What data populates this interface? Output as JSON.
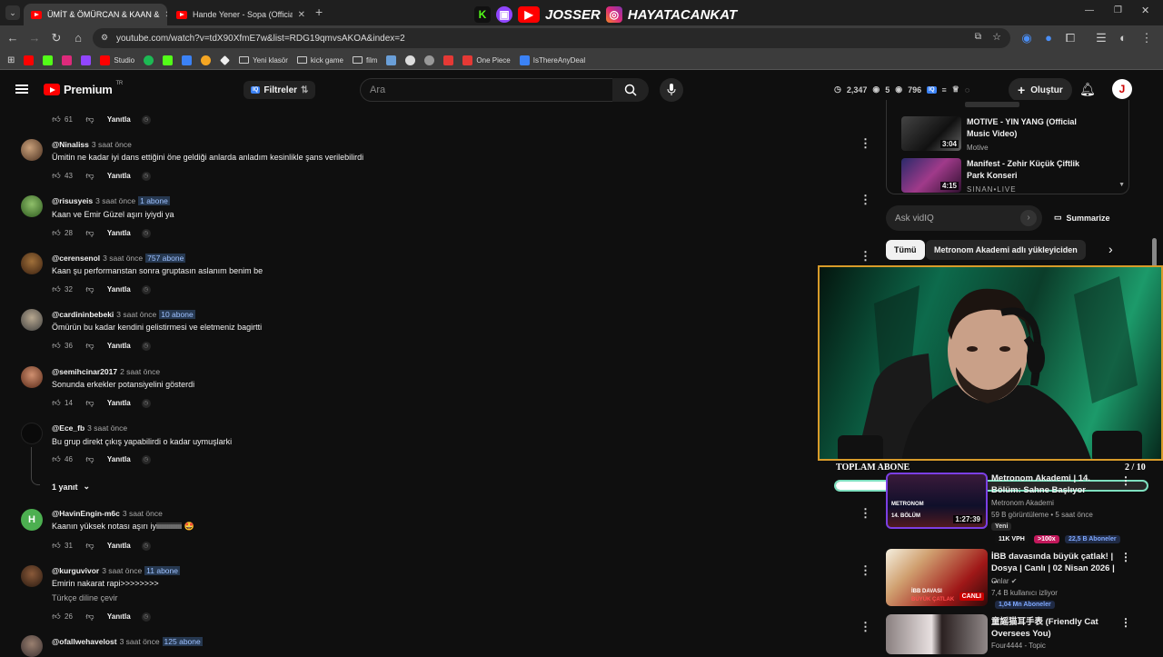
{
  "browser": {
    "tabs": [
      {
        "title": "ÜMİT & ÖMÜRCAN & KAAN &",
        "active": true
      },
      {
        "title": "Hande Yener - Sopa (Official Vi",
        "active": false
      }
    ],
    "new_tab": "+",
    "url": "youtube.com/watch?v=tdX90XfmE7w&list=RDG19qmvsAKOA&index=2",
    "bookmarks": [
      "Studio",
      "Yeni klasör",
      "kick game",
      "film",
      "One Piece",
      "IsThereAnyDeal"
    ]
  },
  "stream_banner": {
    "name1": "JOSSER",
    "name2": "HAYATACANKAT",
    "kick_letter": "K"
  },
  "yt_header": {
    "logo": "Premium",
    "region": "TR",
    "filters": "Filtreler",
    "search_placeholder": "Ara",
    "stats": [
      "2,347",
      "5",
      "796"
    ],
    "create": "Oluştur",
    "avatar_letter": "J"
  },
  "comments": [
    {
      "user": "",
      "time": "",
      "badge": "",
      "text": "",
      "likes": "61",
      "reply": "Yanıtla"
    },
    {
      "user": "@Ninaliss",
      "time": "3 saat önce",
      "badge": "",
      "text": "Ümitin ne kadar iyi dans ettiğini öne geldiği anlarda anladım kesinlikle şans verilebilirdi",
      "likes": "43",
      "reply": "Yanıtla"
    },
    {
      "user": "@risusyeis",
      "time": "3 saat önce",
      "badge": "1 abone",
      "text": "Kaan ve Emir Güzel aşırı iyiydi ya",
      "likes": "28",
      "reply": "Yanıtla"
    },
    {
      "user": "@cerensenol",
      "time": "3 saat önce",
      "badge": "757 abone",
      "text": "Kaan şu performanstan sonra gruptasın aslanım benim be",
      "likes": "32",
      "reply": "Yanıtla"
    },
    {
      "user": "@cardininbebeki",
      "time": "3 saat önce",
      "badge": "10 abone",
      "text": "Ömürün bu kadar kendini gelistirmesi ve eletmeniz bagirtti",
      "likes": "36",
      "reply": "Yanıtla"
    },
    {
      "user": "@semihcinar2017",
      "time": "2 saat önce",
      "badge": "",
      "text": "Sonunda erkekler potansiyelini gösterdi",
      "likes": "14",
      "reply": "Yanıtla"
    },
    {
      "user": "@Ece_fb",
      "time": "3 saat önce",
      "badge": "",
      "text": "Bu grup direkt çıkış yapabilirdi o kadar uymuşlarki",
      "likes": "46",
      "reply": "Yanıtla"
    },
    {
      "user": "@HavinEngin-m6c",
      "time": "3 saat önce",
      "badge": "",
      "text": "Kaanın yüksek notası aşırı iyiiiiiiiiiiiiii 🤩",
      "likes": "31",
      "reply": "Yanıtla"
    },
    {
      "user": "@kurguvivor",
      "time": "3 saat önce",
      "badge": "11 abone",
      "text": "Emirin nakarat rapi>>>>>>>>",
      "translate": "Türkçe diline çevir",
      "likes": "26",
      "reply": "Yanıtla"
    },
    {
      "user": "@ofallwehavelost",
      "time": "3 saat önce",
      "badge": "125 abone",
      "text": "",
      "likes": "",
      "reply": ""
    }
  ],
  "replies_toggle": "1 yanıt",
  "playlist": [
    {
      "title": "MOTIVE - YIN YANG (Official Music Video)",
      "channel": "Motive",
      "duration": "3:04"
    },
    {
      "title": "Manifest - Zehir Küçük Çiftlik Park Konseri",
      "channel": "SINAN•LIVE",
      "duration": "4:15"
    }
  ],
  "ask": {
    "placeholder": "Ask vidIQ",
    "summarize": "Summarize"
  },
  "chips": [
    "Tümü",
    "Metronom Akademi adlı yükleyiciden"
  ],
  "overlay": {
    "label": "TOPLAM ABONE",
    "page": "2 / 10",
    "progress": 0.2
  },
  "videos": [
    {
      "title": "Metronom Akademi | 14. Bölüm: Sahne Başlıyor",
      "channel": "Metronom Akademi",
      "meta": "59 B görüntüleme • 5 saat önce",
      "new": "Yeni",
      "vph": "11K VPH",
      "mult": ">100x",
      "subs": "22,5 B Aboneler",
      "duration": "1:27:39",
      "thumb_text1": "METRONOM",
      "thumb_text2": "14. BÖLÜM"
    },
    {
      "title": "İBB davasında büyük çatlak! | Dosya | Canlı | 02 Nisan 2026 | ...",
      "channel": "Onlar",
      "meta": "7,4 B kullanıcı izliyor",
      "subs": "1,04 Mn Aboneler",
      "live": "CANLI",
      "thumb_text1": "İBB DAVASI",
      "thumb_text2": "BÜYÜK ÇATLAK"
    },
    {
      "title": "童謡猫耳手表 (Friendly Cat Oversees You)",
      "channel": "Four4444 - Topic"
    }
  ]
}
